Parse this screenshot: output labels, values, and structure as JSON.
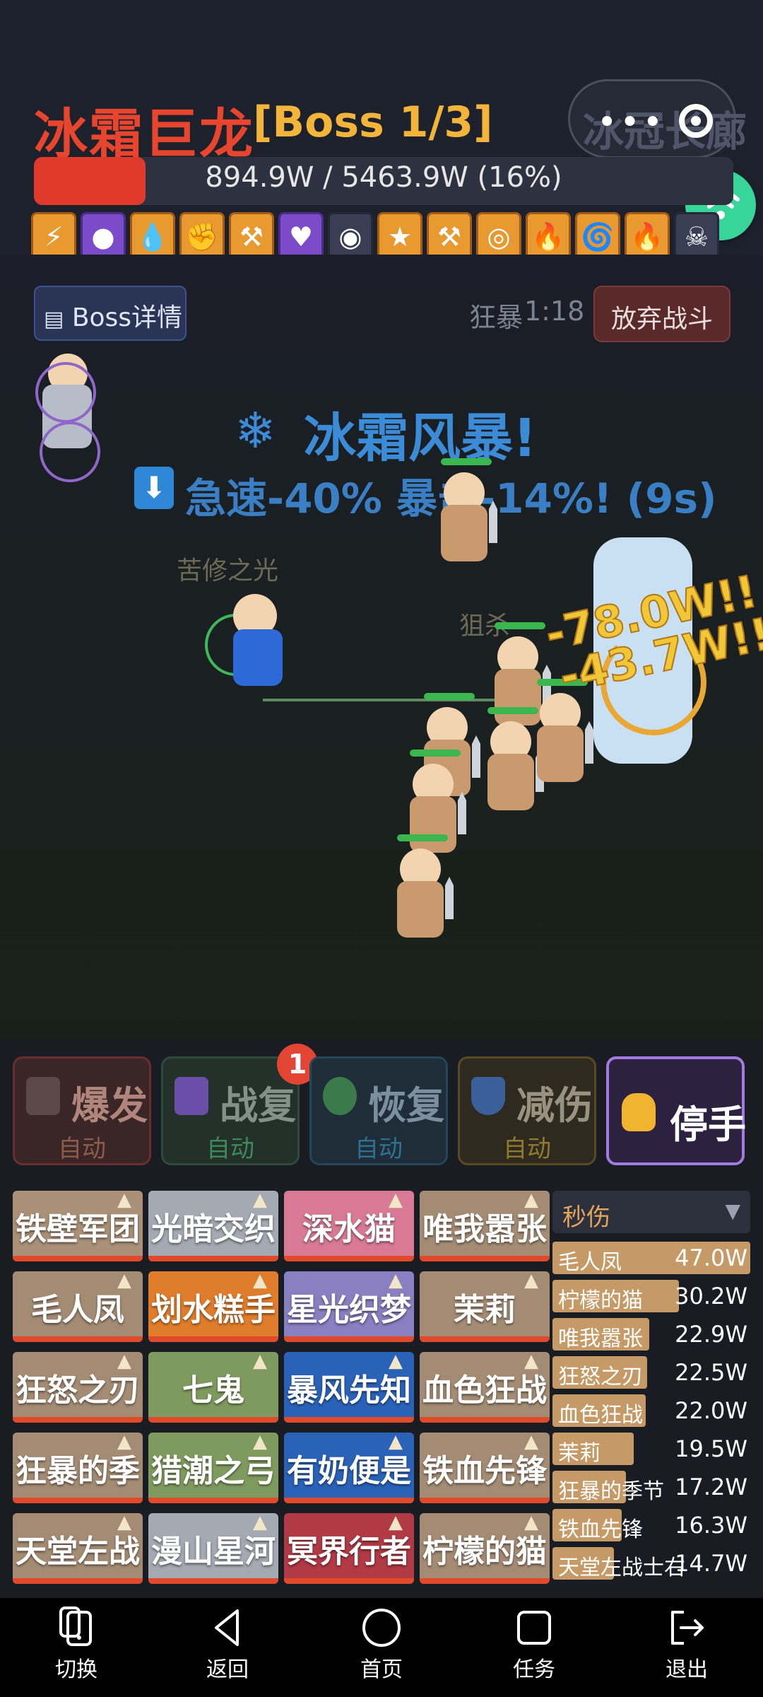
{
  "header": {
    "boss_name": "冰霜巨龙",
    "boss_stage": "[Boss 1/3]",
    "capsule_text": "冰冠长廊",
    "hp_text": "894.9W / 5463.9W (16%)",
    "hp_fraction": 0.16,
    "buff_icons": [
      "lightning-icon",
      "orb-icon",
      "drop-icon",
      "muscle-icon",
      "hammer-icon",
      "heart-icon",
      "shadow-icon",
      "star-icon",
      "hammer-icon",
      "target-icon",
      "fire-icon",
      "tornado-icon",
      "fire-icon",
      "skull-icon"
    ]
  },
  "field": {
    "boss_detail_label": "Boss详情",
    "berserk_label": "狂暴",
    "berserk_time": "1:18",
    "abandon_label": "放弃战斗",
    "skill_banner": "冰霜风暴!",
    "debuff_text": "急速-40% 暴击-14%! (9s)",
    "damage_popup_1": "-78.0W!!",
    "damage_popup_2": "-43.7W!!",
    "float_label_1": "苦修之光",
    "float_label_2": "狙杀"
  },
  "skills": {
    "burst": {
      "name": "爆发",
      "mode": "自动"
    },
    "revive": {
      "name": "战复",
      "mode": "自动"
    },
    "recover": {
      "name": "恢复",
      "mode": "自动"
    },
    "reduce": {
      "name": "减伤",
      "mode": "自动"
    },
    "stop": {
      "name": "停手"
    },
    "badge": "1"
  },
  "roster": {
    "cards": [
      {
        "name": "铁壁军团",
        "color": "#a99077"
      },
      {
        "name": "光暗交织",
        "color": "#a4a9b2"
      },
      {
        "name": "深水猫",
        "color": "#d87a95"
      },
      {
        "name": "唯我嚣张",
        "color": "#a48c74"
      },
      {
        "name": "毛人凤",
        "color": "#a48c74"
      },
      {
        "name": "划水糕手",
        "color": "#df7d2c"
      },
      {
        "name": "星光织梦",
        "color": "#8a7fc0"
      },
      {
        "name": "茉莉",
        "color": "#a48c74"
      },
      {
        "name": "狂怒之刃",
        "color": "#a48c74"
      },
      {
        "name": "七鬼",
        "color": "#7f9a5e"
      },
      {
        "name": "暴风先知",
        "color": "#2a62b8"
      },
      {
        "name": "血色狂战",
        "color": "#a48c74"
      },
      {
        "name": "狂暴的季",
        "color": "#a48c74"
      },
      {
        "name": "猎潮之弓",
        "color": "#7f9a5e"
      },
      {
        "name": "有奶便是",
        "color": "#2a62b8"
      },
      {
        "name": "铁血先锋",
        "color": "#a48c74"
      },
      {
        "name": "天堂左战",
        "color": "#a48c74"
      },
      {
        "name": "漫山星河",
        "color": "#a4a9b2"
      },
      {
        "name": "冥界行者",
        "color": "#b03a45"
      },
      {
        "name": "柠檬的猫",
        "color": "#a48c74"
      }
    ],
    "dps_title": "秒伤",
    "dps": [
      {
        "name": "毛人凤",
        "value": "47.0W",
        "fraction": 1.0
      },
      {
        "name": "柠檬的猫",
        "value": "30.2W",
        "fraction": 0.64
      },
      {
        "name": "唯我嚣张",
        "value": "22.9W",
        "fraction": 0.49
      },
      {
        "name": "狂怒之刃",
        "value": "22.5W",
        "fraction": 0.48
      },
      {
        "name": "血色狂战",
        "value": "22.0W",
        "fraction": 0.47
      },
      {
        "name": "茉莉",
        "value": "19.5W",
        "fraction": 0.41
      },
      {
        "name": "狂暴的季节",
        "value": "17.2W",
        "fraction": 0.37
      },
      {
        "name": "铁血先锋",
        "value": "16.3W",
        "fraction": 0.35
      },
      {
        "name": "天堂左战士右",
        "value": "14.7W",
        "fraction": 0.31
      }
    ]
  },
  "nav": {
    "switch": "切换",
    "back": "返回",
    "home": "首页",
    "tasks": "任务",
    "exit": "退出"
  }
}
